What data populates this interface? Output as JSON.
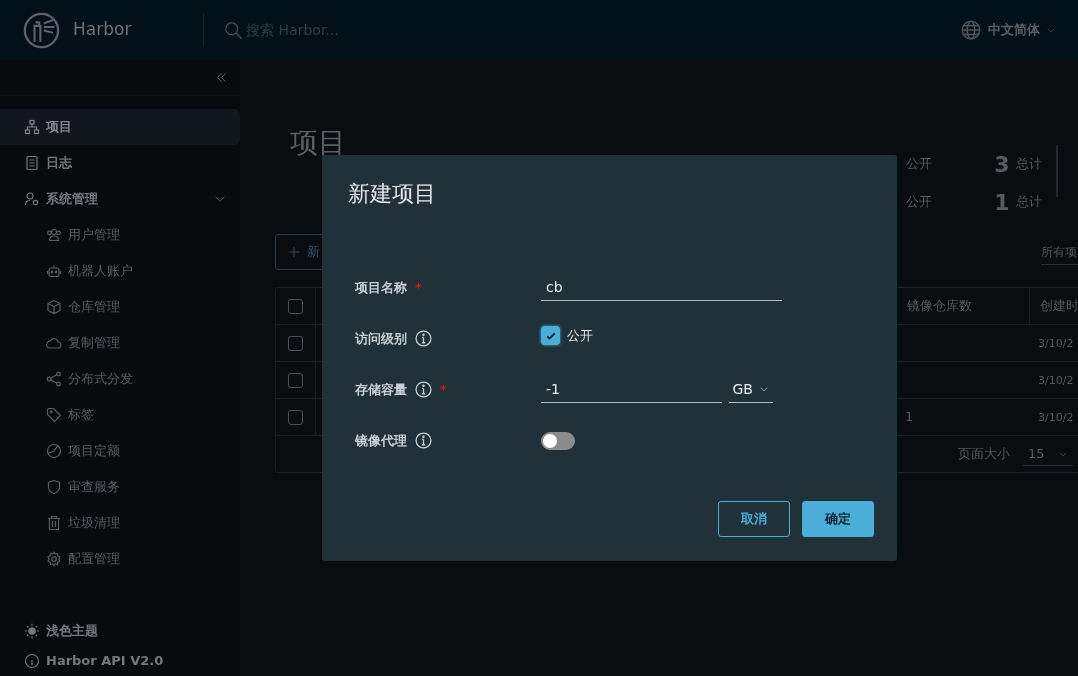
{
  "header": {
    "brand": "Harbor",
    "search": {
      "placeholder": "搜索 Harbor..."
    },
    "language": "中文简体"
  },
  "sidebar": {
    "items": [
      {
        "label": "项目",
        "selected": true
      },
      {
        "label": "日志",
        "selected": false
      },
      {
        "label": "系统管理",
        "selected": false,
        "expanded": true,
        "children": [
          {
            "label": "用户管理",
            "selected": false
          },
          {
            "label": "机器人账户",
            "selected": false
          },
          {
            "label": "仓库管理",
            "selected": false
          },
          {
            "label": "复制管理",
            "selected": false
          },
          {
            "label": "分布式分发",
            "selected": false
          },
          {
            "label": "标签",
            "selected": false
          },
          {
            "label": "项目定额",
            "selected": false
          },
          {
            "label": "审查服务",
            "selected": false
          },
          {
            "label": "垃圾清理",
            "selected": false
          },
          {
            "label": "配置管理",
            "selected": false
          }
        ]
      }
    ],
    "footer": [
      "浅色主题",
      "Harbor API V2.0"
    ]
  },
  "page": {
    "title": "项目",
    "stats": [
      {
        "public_label": "公开",
        "total": "3",
        "total_label": "总计"
      },
      {
        "public_label": "公开",
        "total": "1",
        "total_label": "总计"
      }
    ],
    "new_button": "新",
    "filter": "所有项"
  },
  "table": {
    "columns": [
      "镜像仓库数",
      "创建时"
    ],
    "all_selected": false,
    "rows": [
      {
        "selected": false,
        "created": "3/10/2"
      },
      {
        "selected": false,
        "created": "3/10/2"
      },
      {
        "selected": false,
        "repo_count": "1",
        "created": "3/10/2"
      }
    ],
    "page_size_label": "页面大小",
    "page_size": "15"
  },
  "dialog": {
    "title": "新建项目",
    "fields": [
      {
        "kind": "text",
        "label": "项目名称",
        "required_mark": "*",
        "value": "cb"
      },
      {
        "kind": "checkbox",
        "label": "访问级别",
        "info": true,
        "checked": true,
        "option": "公开"
      },
      {
        "kind": "quota",
        "label": "存储容量",
        "info": true,
        "required_mark": "*",
        "value": "-1",
        "unit": "GB"
      },
      {
        "kind": "toggle",
        "label": "镜像代理",
        "info": true,
        "on": false
      }
    ],
    "buttons": [
      {
        "label": "取消",
        "kind": "outline"
      },
      {
        "label": "确定",
        "kind": "primary"
      }
    ]
  }
}
